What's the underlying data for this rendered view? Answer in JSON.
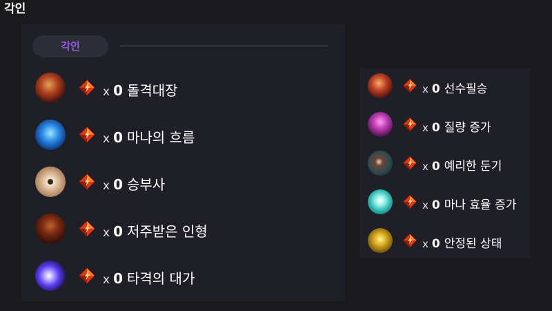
{
  "page_title": "각인",
  "section_label": "각인",
  "multiplier_symbol": "x",
  "gem_icon": "engraving-gem-icon",
  "colors": {
    "background": "#1a1a1d",
    "panel": "#1f1f27",
    "pill": "#2b2d37",
    "pill_text": "#9b59e6",
    "divider": "#5b5d68",
    "gem_red": "#d9371f",
    "gem_orange": "#ff7a2a"
  },
  "primary_engravings": [
    {
      "name": "돌격대장",
      "count": "0",
      "icon": "charge-captain-icon"
    },
    {
      "name": "마나의 흐름",
      "count": "0",
      "icon": "mana-flow-icon"
    },
    {
      "name": "승부사",
      "count": "0",
      "icon": "gambler-eye-icon"
    },
    {
      "name": "저주받은 인형",
      "count": "0",
      "icon": "cursed-doll-icon"
    },
    {
      "name": "타격의 대가",
      "count": "0",
      "icon": "hit-master-icon"
    }
  ],
  "secondary_engravings": [
    {
      "name": "선수필승",
      "count": "0",
      "icon": "preemptive-strike-icon"
    },
    {
      "name": "질량 증가",
      "count": "0",
      "icon": "mass-increase-icon"
    },
    {
      "name": "예리한 둔기",
      "count": "0",
      "icon": "keen-blunt-weapon-icon"
    },
    {
      "name": "마나 효율 증가",
      "count": "0",
      "icon": "mana-efficiency-icon"
    },
    {
      "name": "안정된 상태",
      "count": "0",
      "icon": "stabilized-status-icon"
    }
  ]
}
